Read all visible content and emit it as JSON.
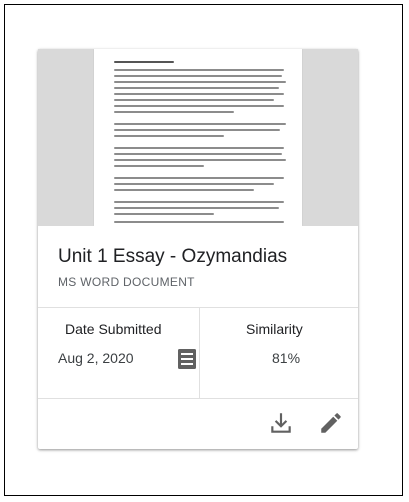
{
  "card": {
    "title": "Unit 1 Essay - Ozymandias",
    "subtitle": "MS WORD DOCUMENT",
    "date_label": "Date Submitted",
    "date_value": "Aug 2, 2020",
    "similarity_label": "Similarity",
    "similarity_value": "81%"
  },
  "icons": {
    "document": "document-icon",
    "download": "download-icon",
    "edit": "pencil-icon"
  },
  "colors": {
    "accent_text": "#202124",
    "secondary_text": "#5f6368",
    "icon": "#616161",
    "thumbnail_bg": "#d9d9d9"
  }
}
